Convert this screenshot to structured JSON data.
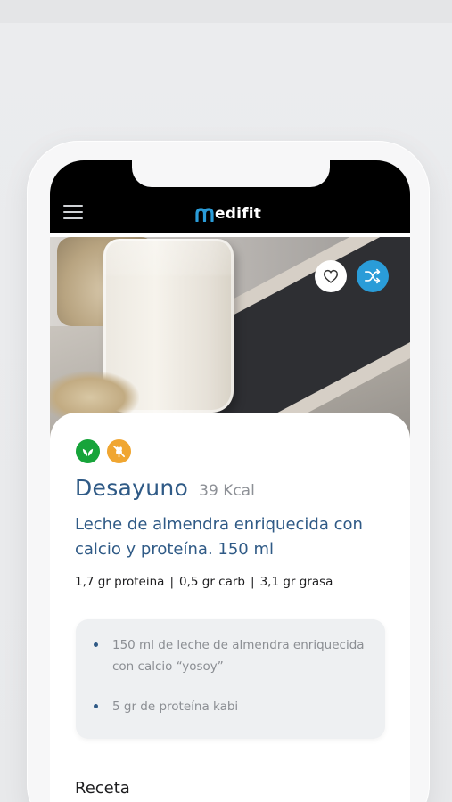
{
  "app": {
    "logo_text": "edifit",
    "brand_color": "#2a9cd8"
  },
  "header": {
    "menu_icon": "hamburger-menu-icon"
  },
  "hero": {
    "fav_icon": "heart-outline-icon",
    "shuffle_icon": "shuffle-icon"
  },
  "meal": {
    "diet_tags": [
      {
        "icon": "leaf-icon",
        "color": "#17a43a"
      },
      {
        "icon": "gluten-free-icon",
        "color": "#f0a631"
      }
    ],
    "title": "Desayuno",
    "kcal": "39 Kcal",
    "dish": "Leche de almendra enriquecida con calcio y proteína. 150 ml",
    "macros": {
      "protein": "1,7 gr proteina",
      "carb": "0,5 gr carb",
      "fat": "3,1 gr grasa",
      "separator": "|"
    },
    "ingredients": [
      "150 ml de leche de almendra enriquecida con calcio “yosoy”",
      "5 gr de proteína kabi"
    ],
    "recipe_heading": "Receta"
  }
}
